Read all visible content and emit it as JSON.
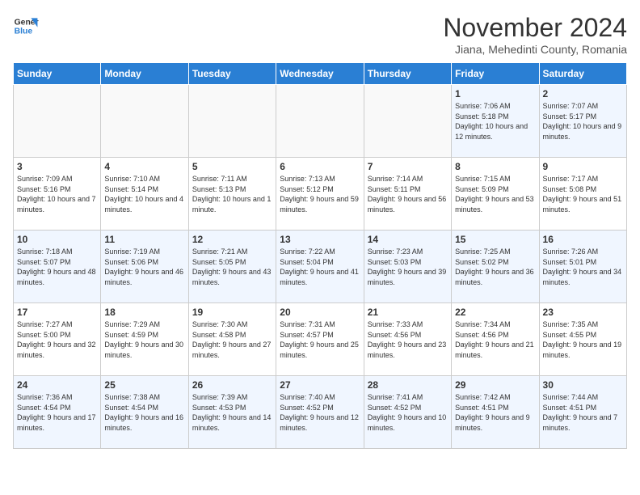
{
  "logo": {
    "line1": "General",
    "line2": "Blue"
  },
  "title": "November 2024",
  "subtitle": "Jiana, Mehedinti County, Romania",
  "days_header": [
    "Sunday",
    "Monday",
    "Tuesday",
    "Wednesday",
    "Thursday",
    "Friday",
    "Saturday"
  ],
  "weeks": [
    [
      {
        "num": "",
        "info": ""
      },
      {
        "num": "",
        "info": ""
      },
      {
        "num": "",
        "info": ""
      },
      {
        "num": "",
        "info": ""
      },
      {
        "num": "",
        "info": ""
      },
      {
        "num": "1",
        "info": "Sunrise: 7:06 AM\nSunset: 5:18 PM\nDaylight: 10 hours and 12 minutes."
      },
      {
        "num": "2",
        "info": "Sunrise: 7:07 AM\nSunset: 5:17 PM\nDaylight: 10 hours and 9 minutes."
      }
    ],
    [
      {
        "num": "3",
        "info": "Sunrise: 7:09 AM\nSunset: 5:16 PM\nDaylight: 10 hours and 7 minutes."
      },
      {
        "num": "4",
        "info": "Sunrise: 7:10 AM\nSunset: 5:14 PM\nDaylight: 10 hours and 4 minutes."
      },
      {
        "num": "5",
        "info": "Sunrise: 7:11 AM\nSunset: 5:13 PM\nDaylight: 10 hours and 1 minute."
      },
      {
        "num": "6",
        "info": "Sunrise: 7:13 AM\nSunset: 5:12 PM\nDaylight: 9 hours and 59 minutes."
      },
      {
        "num": "7",
        "info": "Sunrise: 7:14 AM\nSunset: 5:11 PM\nDaylight: 9 hours and 56 minutes."
      },
      {
        "num": "8",
        "info": "Sunrise: 7:15 AM\nSunset: 5:09 PM\nDaylight: 9 hours and 53 minutes."
      },
      {
        "num": "9",
        "info": "Sunrise: 7:17 AM\nSunset: 5:08 PM\nDaylight: 9 hours and 51 minutes."
      }
    ],
    [
      {
        "num": "10",
        "info": "Sunrise: 7:18 AM\nSunset: 5:07 PM\nDaylight: 9 hours and 48 minutes."
      },
      {
        "num": "11",
        "info": "Sunrise: 7:19 AM\nSunset: 5:06 PM\nDaylight: 9 hours and 46 minutes."
      },
      {
        "num": "12",
        "info": "Sunrise: 7:21 AM\nSunset: 5:05 PM\nDaylight: 9 hours and 43 minutes."
      },
      {
        "num": "13",
        "info": "Sunrise: 7:22 AM\nSunset: 5:04 PM\nDaylight: 9 hours and 41 minutes."
      },
      {
        "num": "14",
        "info": "Sunrise: 7:23 AM\nSunset: 5:03 PM\nDaylight: 9 hours and 39 minutes."
      },
      {
        "num": "15",
        "info": "Sunrise: 7:25 AM\nSunset: 5:02 PM\nDaylight: 9 hours and 36 minutes."
      },
      {
        "num": "16",
        "info": "Sunrise: 7:26 AM\nSunset: 5:01 PM\nDaylight: 9 hours and 34 minutes."
      }
    ],
    [
      {
        "num": "17",
        "info": "Sunrise: 7:27 AM\nSunset: 5:00 PM\nDaylight: 9 hours and 32 minutes."
      },
      {
        "num": "18",
        "info": "Sunrise: 7:29 AM\nSunset: 4:59 PM\nDaylight: 9 hours and 30 minutes."
      },
      {
        "num": "19",
        "info": "Sunrise: 7:30 AM\nSunset: 4:58 PM\nDaylight: 9 hours and 27 minutes."
      },
      {
        "num": "20",
        "info": "Sunrise: 7:31 AM\nSunset: 4:57 PM\nDaylight: 9 hours and 25 minutes."
      },
      {
        "num": "21",
        "info": "Sunrise: 7:33 AM\nSunset: 4:56 PM\nDaylight: 9 hours and 23 minutes."
      },
      {
        "num": "22",
        "info": "Sunrise: 7:34 AM\nSunset: 4:56 PM\nDaylight: 9 hours and 21 minutes."
      },
      {
        "num": "23",
        "info": "Sunrise: 7:35 AM\nSunset: 4:55 PM\nDaylight: 9 hours and 19 minutes."
      }
    ],
    [
      {
        "num": "24",
        "info": "Sunrise: 7:36 AM\nSunset: 4:54 PM\nDaylight: 9 hours and 17 minutes."
      },
      {
        "num": "25",
        "info": "Sunrise: 7:38 AM\nSunset: 4:54 PM\nDaylight: 9 hours and 16 minutes."
      },
      {
        "num": "26",
        "info": "Sunrise: 7:39 AM\nSunset: 4:53 PM\nDaylight: 9 hours and 14 minutes."
      },
      {
        "num": "27",
        "info": "Sunrise: 7:40 AM\nSunset: 4:52 PM\nDaylight: 9 hours and 12 minutes."
      },
      {
        "num": "28",
        "info": "Sunrise: 7:41 AM\nSunset: 4:52 PM\nDaylight: 9 hours and 10 minutes."
      },
      {
        "num": "29",
        "info": "Sunrise: 7:42 AM\nSunset: 4:51 PM\nDaylight: 9 hours and 9 minutes."
      },
      {
        "num": "30",
        "info": "Sunrise: 7:44 AM\nSunset: 4:51 PM\nDaylight: 9 hours and 7 minutes."
      }
    ]
  ]
}
